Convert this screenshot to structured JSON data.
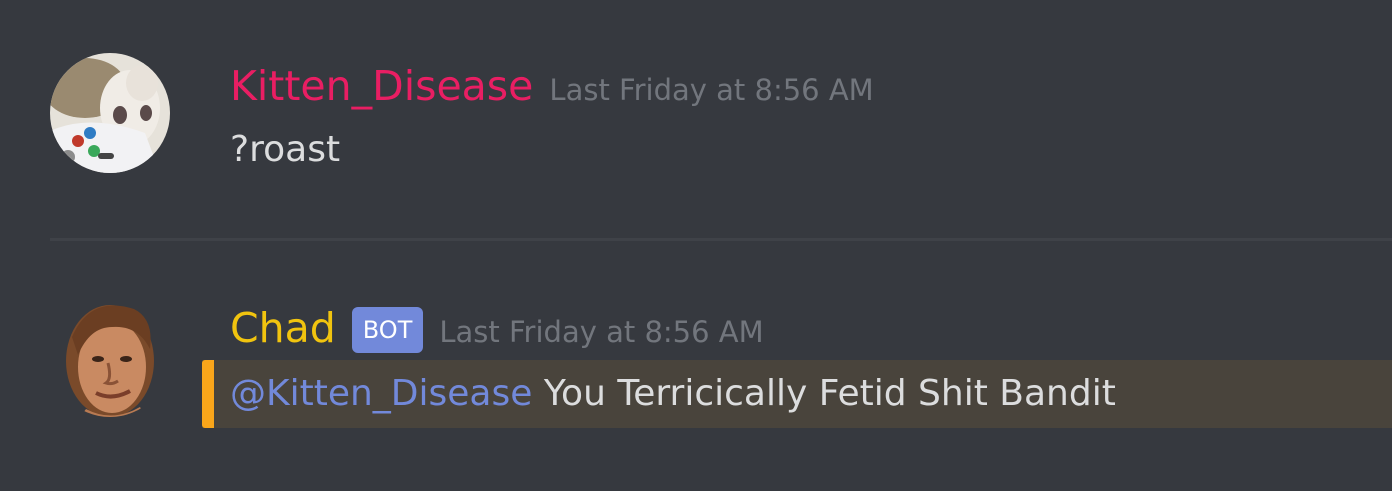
{
  "messages": [
    {
      "username": "Kitten_Disease",
      "timestamp": "Last Friday at 8:56 AM",
      "content": "?roast",
      "username_color": "#e91e63",
      "avatar_icon": "kitten-controller-avatar"
    },
    {
      "username": "Chad",
      "badge": "BOT",
      "timestamp": "Last Friday at 8:56 AM",
      "mention": "@Kitten_Disease",
      "content": " You Terricically Fetid Shit Bandit",
      "username_color": "#f1c40f",
      "avatar_icon": "chad-face-avatar"
    }
  ],
  "colors": {
    "background": "#36393f",
    "mention_highlight": "#49443c",
    "mention_bar": "#faa61a",
    "mention_text": "#7289da",
    "bot_badge": "#7289da"
  }
}
